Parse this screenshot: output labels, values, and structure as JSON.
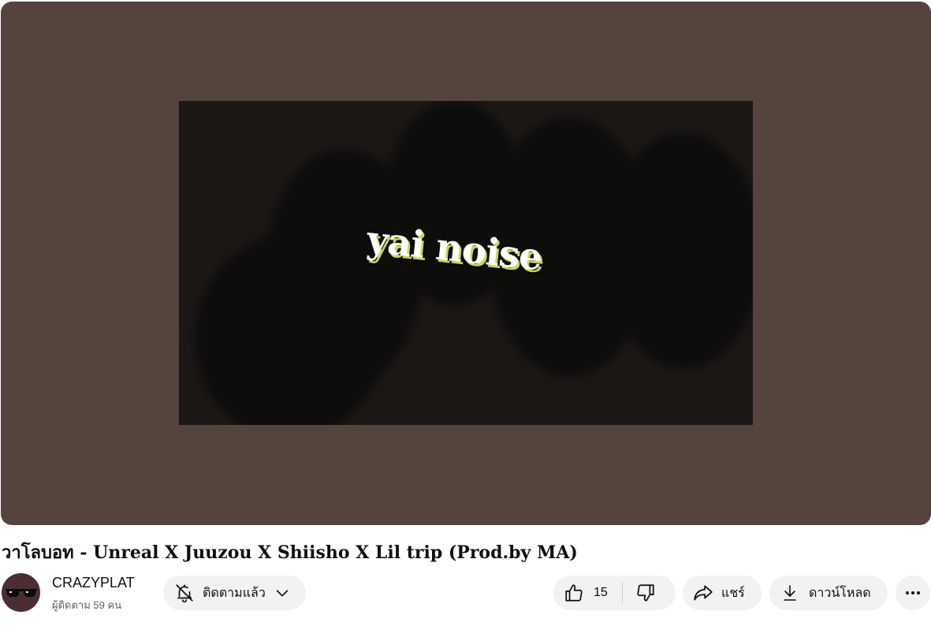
{
  "player": {
    "watermark_text": "yai noise"
  },
  "video": {
    "title": "วาโลบอท - Unreal X Juuzou X Shiisho X Lil trip (Prod.by MA)"
  },
  "channel": {
    "name": "CRAZYPLAT",
    "subscribers": "ผู้ติดตาม 59 คน",
    "avatar_icon": "pixel-sunglasses-avatar"
  },
  "actions": {
    "subscribe_label": "ติดตามแล้ว",
    "like_count": "15",
    "share_label": "แชร์",
    "download_label": "ดาวน์โหลด"
  },
  "icons": {
    "bell": "bell-off-icon",
    "chevron": "chevron-down-icon",
    "like": "thumbs-up-icon",
    "dislike": "thumbs-down-icon",
    "share": "share-arrow-icon",
    "download": "download-icon",
    "more": "more-horizontal-icon"
  },
  "colors": {
    "player_background": "#54443d",
    "pill_background": "#f2f2f2",
    "watermark_outline": "#c9d84a"
  }
}
